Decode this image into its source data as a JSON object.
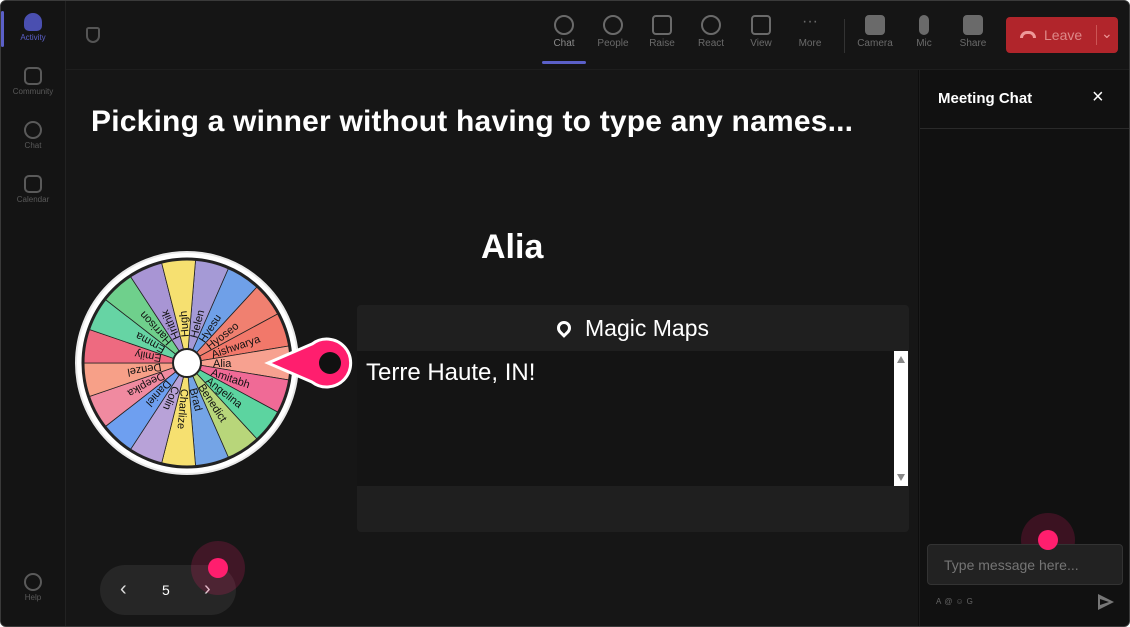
{
  "rail": {
    "items": [
      {
        "label": "Activity",
        "icon": "bell-icon"
      },
      {
        "label": "Community",
        "icon": "community-icon"
      },
      {
        "label": "Chat",
        "icon": "chat-icon"
      },
      {
        "label": "Calendar",
        "icon": "calendar-icon"
      },
      {
        "label": "Help",
        "icon": "help-icon"
      }
    ]
  },
  "toolbar": {
    "buttons": [
      {
        "label": "Chat",
        "icon": "chat-icon"
      },
      {
        "label": "People",
        "icon": "people-icon"
      },
      {
        "label": "Raise",
        "icon": "hand-icon"
      },
      {
        "label": "React",
        "icon": "smiley-icon"
      },
      {
        "label": "View",
        "icon": "grid-icon"
      },
      {
        "label": "More",
        "icon": "ellipsis-icon"
      },
      {
        "label": "Camera",
        "icon": "camera-icon"
      },
      {
        "label": "Mic",
        "icon": "mic-icon"
      },
      {
        "label": "Share",
        "icon": "share-icon"
      }
    ],
    "leave_label": "Leave",
    "leave_color": "#b1252b"
  },
  "stage": {
    "headline": "Picking a winner without having to type any names...",
    "winner": "Alia",
    "wheel": {
      "names": [
        "Helen",
        "Hyesu",
        "Hyoseo",
        "Aishwarya",
        "Alia",
        "Amitabh",
        "Angelina",
        "Benedict",
        "Brad",
        "Charlize",
        "Colin",
        "Daniel",
        "Deepika",
        "Denzel",
        "Emily",
        "Emma",
        "Harrison",
        "Hrithik",
        "Hugh"
      ],
      "colors": [
        "#a59ad6",
        "#6fa0e8",
        "#f08070",
        "#f2786a",
        "#f7a190",
        "#f06a96",
        "#5cd4a0",
        "#b8d67a",
        "#74a4e6",
        "#f6e070",
        "#b8a2d8",
        "#6e9ff0",
        "#f08aa0",
        "#f7a088",
        "#ee6a80",
        "#66d4a4",
        "#6fd08c",
        "#a895d4",
        "#f6e070"
      ],
      "pointer_color": "#ff1e6e"
    },
    "maps": {
      "title": "Magic Maps",
      "body": "Terre Haute, IN!"
    },
    "pager": {
      "page": "5"
    }
  },
  "chat": {
    "title": "Meeting Chat",
    "placeholder": "Type message here..."
  }
}
